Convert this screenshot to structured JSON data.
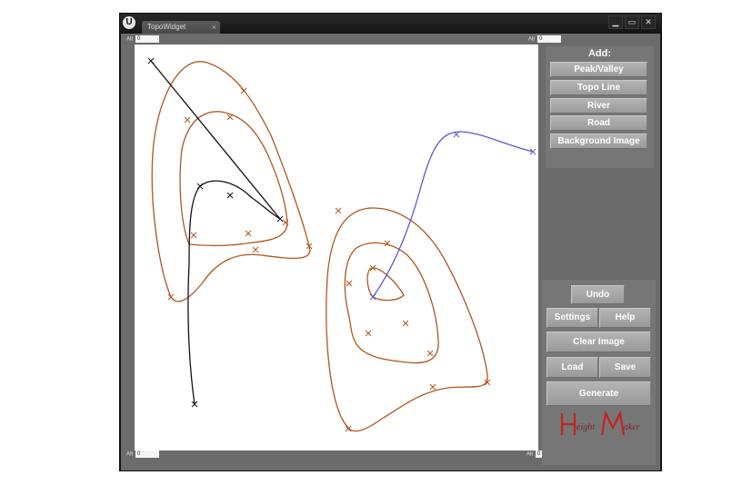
{
  "window": {
    "tab_label": "TopoWidget",
    "tab_close": "×",
    "controls": {
      "minimize": "▁",
      "maximize": "▭",
      "close": "✕"
    }
  },
  "alt_fields": {
    "label": "Alt",
    "top_left": "0",
    "top_right": "0",
    "bottom_left": "0",
    "bottom_right": "0"
  },
  "add_panel": {
    "title": "Add:",
    "buttons": [
      "Peak/Valley",
      "Topo Line",
      "River",
      "Road",
      "Background Image"
    ]
  },
  "actions": {
    "undo": "Undo",
    "settings": "Settings",
    "help": "Help",
    "clear_image": "Clear Image",
    "load": "Load",
    "save": "Save",
    "generate": "Generate"
  },
  "logo": {
    "text": "HeightMaker"
  },
  "colors": {
    "topo_line": "#b0571f",
    "road": "#111111",
    "river": "#5a5ad0",
    "logo_red": "#c82020"
  }
}
